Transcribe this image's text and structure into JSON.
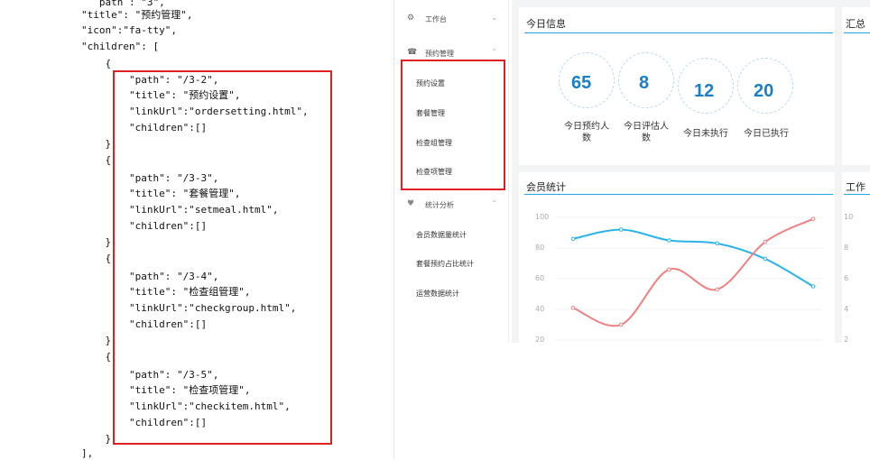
{
  "code": {
    "lines": [
      "   path : \"3\",",
      "\"title\": \"预约管理\",",
      "\"icon\":\"fa-tty\",",
      "\"children\": [",
      "    {",
      "        \"path\": \"/3-2\",",
      "        \"title\": \"预约设置\",",
      "        \"linkUrl\":\"ordersetting.html\",",
      "        \"children\":[]",
      "    },",
      "    {",
      "        \"path\": \"/3-3\",",
      "        \"title\": \"套餐管理\",",
      "        \"linkUrl\":\"setmeal.html\",",
      "        \"children\":[]",
      "    },",
      "    {",
      "        \"path\": \"/3-4\",",
      "        \"title\": \"检查组管理\",",
      "        \"linkUrl\":\"checkgroup.html\",",
      "        \"children\":[]",
      "    },",
      "    {",
      "        \"path\": \"/3-5\",",
      "        \"title\": \"检查项管理\",",
      "        \"linkUrl\":\"checkitem.html\",",
      "        \"children\":[]",
      "    }",
      "],"
    ]
  },
  "sidebar": {
    "workbench": "工作台",
    "booking": "预约管理",
    "booking_items": [
      "预约设置",
      "套餐管理",
      "检查组管理",
      "检查项管理"
    ],
    "stats": "统计分析",
    "stats_items": [
      "会员数据量统计",
      "套餐预约占比统计",
      "运营数据统计"
    ]
  },
  "today": {
    "title": "今日信息",
    "items": [
      {
        "value": "65",
        "label": "今日预约人\n数"
      },
      {
        "value": "8",
        "label": "今日评估人\n数"
      },
      {
        "value": "12",
        "label": "今日未执行"
      },
      {
        "value": "20",
        "label": "今日已执行"
      }
    ]
  },
  "summary_title": "汇总",
  "members": {
    "title": "会员统计",
    "yticks": [
      "100",
      "80",
      "60",
      "40",
      "20"
    ]
  },
  "work_title": "工作",
  "work_yticks": [
    "10",
    "8",
    "6",
    "4",
    "2"
  ],
  "chart_data": {
    "type": "line",
    "ylim": [
      20,
      100
    ],
    "x": [
      1,
      2,
      3,
      4,
      5,
      6
    ],
    "series": [
      {
        "values": [
          86,
          92,
          85,
          83,
          73,
          55
        ],
        "color": "#2bb3ea"
      },
      {
        "values": [
          41,
          30,
          66,
          53,
          84,
          99
        ],
        "color": "#f08080"
      }
    ]
  },
  "colors": {
    "accent": "#22a7e4",
    "highlight": "#e02020"
  }
}
